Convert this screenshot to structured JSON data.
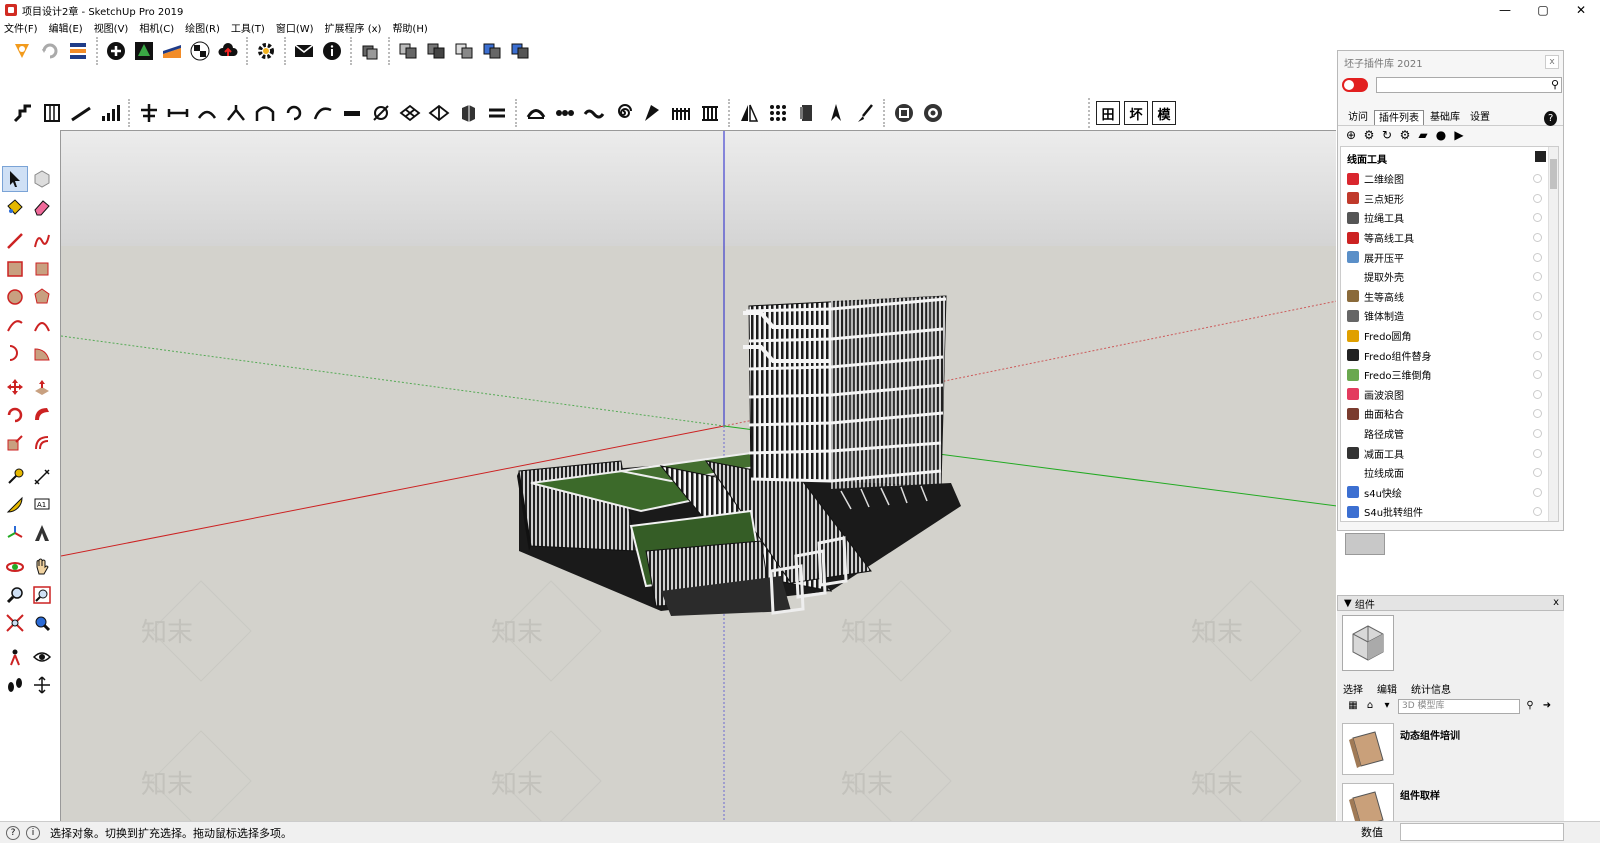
{
  "window": {
    "title": "项目设计2章 - SketchUp Pro 2019",
    "controls": {
      "minimize": "—",
      "maximize": "▢",
      "close": "✕"
    }
  },
  "menu": {
    "items": [
      "文件(F)",
      "编辑(E)",
      "视图(V)",
      "相机(C)",
      "绘图(R)",
      "工具(T)",
      "窗口(W)",
      "扩展程序 (x)",
      "帮助(H)"
    ]
  },
  "view_toolbar": {
    "buttons": [
      "田",
      "坏",
      "模"
    ]
  },
  "plugin_panel": {
    "title": "坯子插件库 2021",
    "close": "x",
    "search_placeholder": "",
    "tabs": [
      "访问",
      "插件列表",
      "基础库",
      "设置"
    ],
    "active_tab": "插件列表",
    "help": "?",
    "category": "线面工具",
    "items": [
      {
        "label": "二维绘图",
        "color": "#d9262e"
      },
      {
        "label": "三点矩形",
        "color": "#c0392b"
      },
      {
        "label": "拉绳工具",
        "color": "#555555"
      },
      {
        "label": "等高线工具",
        "color": "#cc2222"
      },
      {
        "label": "展开压平",
        "color": "#5a8fc8"
      },
      {
        "label": "提取外壳",
        "color": ""
      },
      {
        "label": "生等高线",
        "color": "#8a6a3a"
      },
      {
        "label": "锥体制造",
        "color": "#666666"
      },
      {
        "label": "Fredo圆角",
        "color": "#e0a000"
      },
      {
        "label": "Fredo组件替身",
        "color": "#222222"
      },
      {
        "label": "Fredo三维倒角",
        "color": "#6aa84f"
      },
      {
        "label": "画波浪图",
        "color": "#e33b5e"
      },
      {
        "label": "曲面粘合",
        "color": "#7a3b2e"
      },
      {
        "label": "路径成管",
        "color": ""
      },
      {
        "label": "减面工具",
        "color": "#333333"
      },
      {
        "label": "拉线成面",
        "color": ""
      },
      {
        "label": "s4u快绘",
        "color": "#3c6fd1"
      },
      {
        "label": "S4u批转组件",
        "color": "#3c6fd1"
      }
    ]
  },
  "components_tray": {
    "header": "组件",
    "close": "x",
    "tabs": [
      "选择",
      "编辑",
      "统计信息"
    ],
    "search_placeholder": "3D 模型库",
    "items": [
      "动态组件培训",
      "组件取样"
    ]
  },
  "status": {
    "message": "选择对象。切换到扩充选择。拖动鼠标选择多项。",
    "measure_label": "数值",
    "measure_value": ""
  },
  "watermark": "知末"
}
